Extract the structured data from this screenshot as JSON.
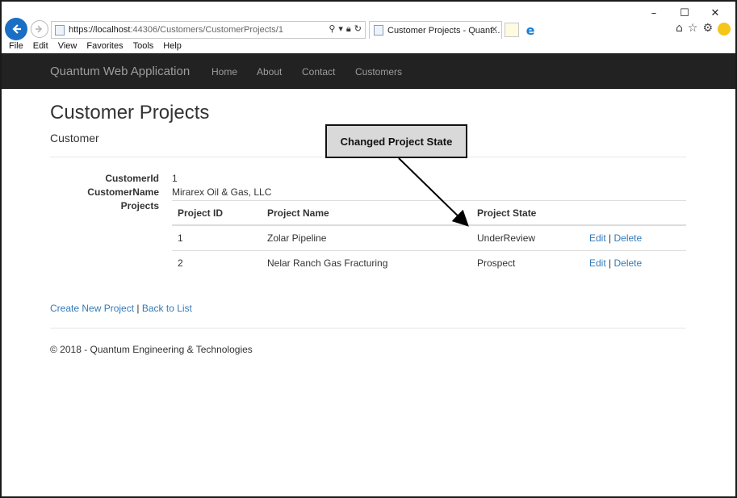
{
  "browser": {
    "address_host": "https://localhost",
    "address_rest": ":44306/Customers/CustomerProjects/1",
    "tab_title": "Customer Projects - Quant...",
    "tab_close": "✕",
    "minimize": "–",
    "maximize": "☐",
    "close": "✕",
    "menu": [
      "File",
      "Edit",
      "View",
      "Favorites",
      "Tools",
      "Help"
    ]
  },
  "navbar": {
    "brand": "Quantum Web Application",
    "links": [
      "Home",
      "About",
      "Contact",
      "Customers"
    ]
  },
  "page": {
    "title": "Customer Projects",
    "subtitle": "Customer",
    "fields": {
      "customer_id_label": "CustomerId",
      "customer_id_value": "1",
      "customer_name_label": "CustomerName",
      "customer_name_value": "Mirarex Oil & Gas, LLC",
      "projects_label": "Projects"
    },
    "table": {
      "headers": [
        "Project ID",
        "Project Name",
        "Project State"
      ],
      "rows": [
        {
          "id": "1",
          "name": "Zolar Pipeline",
          "state": "UnderReview",
          "edit": "Edit",
          "delete": "Delete"
        },
        {
          "id": "2",
          "name": "Nelar Ranch Gas Fracturing",
          "state": "Prospect",
          "edit": "Edit",
          "delete": "Delete"
        }
      ],
      "separator": "|"
    },
    "create_link": "Create New Project",
    "back_link": "Back to List",
    "link_separator": "|",
    "copyright": "© 2018 - Quantum Engineering & Technologies"
  },
  "annotation": {
    "label": "Changed Project State"
  },
  "colors": {
    "navbar_bg": "#222222",
    "nav_text": "#9d9d9d",
    "link": "#337ab7",
    "ie_back": "#1a6fc4"
  }
}
